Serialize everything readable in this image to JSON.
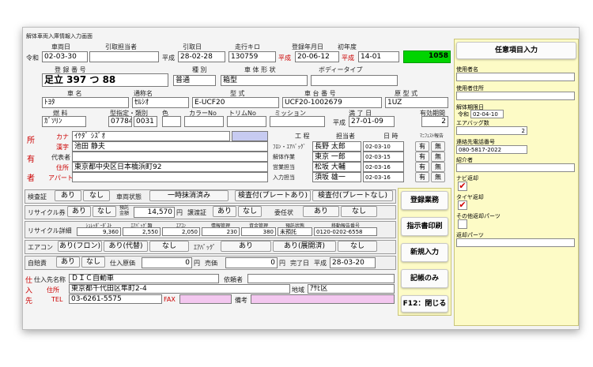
{
  "window": {
    "title": "解体車両入庫情報入力画面"
  },
  "reception": {
    "receive_date_label": "車両日",
    "handler_label": "引取担当者",
    "pickup_date_label": "引取日",
    "mileage_label": "走行キロ",
    "first_reg_label": "登録年月日",
    "inspection_label": "初年度",
    "era": "令和",
    "receive_date": "02-03-30",
    "era2": "平成",
    "pickup_date": "28-02-28",
    "mileage": "130759",
    "era3": "平成",
    "first_reg": "20-06-12",
    "era4": "平成",
    "inspection": "14-01",
    "amount": "1058"
  },
  "plate": {
    "label": "登 録 番 号",
    "type_label": "種 別",
    "body_label": "車 体 形 状",
    "body_type_label": "ボディータイプ",
    "value": "足立 397 つ 88",
    "type": "普通",
    "body": "箱型",
    "body_type": ""
  },
  "car": {
    "name_label": "車 名",
    "common_label": "通称名",
    "model_label": "型 式",
    "chassis_label": "車 台 番 号",
    "engine_label": "原 型 式",
    "name": "ﾄﾖﾀ",
    "common": "ｾﾙｼｵ",
    "model": "E-UCF20",
    "chassis": "UCF20-1002679",
    "engine": "1UZ"
  },
  "fuel": {
    "fuel_label": "燃 料",
    "class_label": "型指定・類別",
    "color_label": "色",
    "colorno_label": "カラーNo",
    "trim_label": "トリムNo",
    "mission_label": "ミッション",
    "expiry_label": "満 了 日",
    "valid_label": "有効期間",
    "fuel": "ｶﾞｿﾘﾝ",
    "class1": "07784",
    "class2": "0031",
    "era": "平成",
    "expiry": "27-01-09",
    "valid": "2"
  },
  "owner": {
    "side1": "所",
    "side2": "有",
    "side3": "者",
    "kana_label": "カナ",
    "kanji_label": "漢字",
    "rep_label": "代表者",
    "addr_label": "住所",
    "apt_label": "アパート",
    "kana": "ｲｹﾀﾞ ｼｽﾞｵ",
    "kanji": "池田 静夫",
    "rep": "",
    "addr": "東京都中央区日本橋浜町92",
    "apt": ""
  },
  "process": {
    "col1": "工 程",
    "col2": "担当者",
    "col3": "日 時",
    "col4": "ﾏﾆﾌｪｽﾄ報告",
    "rows": [
      {
        "step": "ﾌﾛﾝ・ｴｱﾊﾞｯｸﾞ",
        "person": "長野 太郎",
        "date": "02-03-10",
        "yes": "有",
        "no": "無"
      },
      {
        "step": "解体作業",
        "person": "東京 一郎",
        "date": "02-03-15",
        "yes": "有",
        "no": "無"
      },
      {
        "step": "営業担当",
        "person": "松坂 大輔",
        "date": "02-03-16",
        "yes": "有",
        "no": "無"
      },
      {
        "step": "入力担当",
        "person": "須坂 雄一",
        "date": "02-03-16",
        "yes": "有",
        "no": "無"
      }
    ]
  },
  "inspect": {
    "label": "検査証",
    "yes": "あり",
    "no": "なし",
    "state_label": "車両状態",
    "state": "一時抹消済み",
    "b1": "検査付(プレートあり)",
    "b2": "検査付(プレートなし)"
  },
  "recycle": {
    "label": "リサイクル券",
    "yes": "あり",
    "no": "なし",
    "deposit_l1": "預託",
    "deposit_l2": "金額",
    "amount": "14,570",
    "yen": "円",
    "transfer_label": "譲渡証",
    "t_yes": "あり",
    "t_no": "なし",
    "proxy_label": "委任状",
    "p_yes": "あり",
    "p_no": "なし"
  },
  "recycle_detail": {
    "label": "リサイクル詳細",
    "cols": [
      "ｼｭﾚｯﾀﾞｰﾀﾞｽﾄ",
      "ｴｱﾊﾞｯｸﾞ類",
      "ｴｱｺﾝ",
      "情報管理",
      "資金管理",
      "預託状態",
      "移動報告番号"
    ],
    "vals": [
      "9,360",
      "2,550",
      "2,050",
      "230",
      "380",
      "未預託",
      "0120-0202-6558"
    ]
  },
  "aircon": {
    "label": "エアコン",
    "a": "あり(フロン)",
    "b": "あり(代替)",
    "c": "なし",
    "airbag_label": "ｴｱﾊﾞｯｸﾞ",
    "d": "あり",
    "e": "あり(展開済)",
    "f": "なし"
  },
  "self": {
    "label": "自賠責",
    "yes": "あり",
    "no": "なし",
    "cost_label": "仕入原価",
    "cost": "0",
    "yen": "円",
    "sale_label": "売価",
    "sale": "0",
    "yen2": "円",
    "done_label": "完了日",
    "era": "平成",
    "done": "28-03-20"
  },
  "supplier": {
    "side1": "仕",
    "side2": "入",
    "side3": "先",
    "name_label": "仕入先名称",
    "name": "ＤＩＣ自動車",
    "client_label": "依頼者",
    "client": "",
    "addr_label": "住所",
    "addr": "東京都千代田区隼町2-4",
    "region_label": "地域",
    "region": "ｱｻﾋ区",
    "tel_label": "TEL",
    "tel": "03-6261-5575",
    "fax_label": "FAX",
    "fax": "",
    "note_label": "備考",
    "note": ""
  },
  "actions": {
    "register": "登録業務",
    "print": "指示書印刷",
    "new": "新規入力",
    "record": "記帳のみ",
    "close": "F12：閉じる"
  },
  "optional": {
    "title": "任意項目入力",
    "user_name_label": "使用者名",
    "user_name": "",
    "user_addr_label": "使用者住所",
    "user_addr": "",
    "period_label": "解体期限日",
    "period_era": "令和",
    "period": "02-04-10",
    "airbag_label": "エアバッグ数",
    "airbag": "2",
    "phone_label": "連絡先電話番号",
    "phone": "080-5817-2022",
    "intro_label": "紹介者",
    "intro": "",
    "navi_label": "ナビ返却",
    "tire_label": "タイヤ返却",
    "other_label": "その他返却パーツ",
    "ret_label": "返却パーツ",
    "ret": ""
  },
  "colors": {
    "green": "#00d400",
    "red": "#cc0000",
    "yellow": "#fdfbc6",
    "lilac": "#c7cbf1",
    "pink": "#f3c7ef"
  }
}
